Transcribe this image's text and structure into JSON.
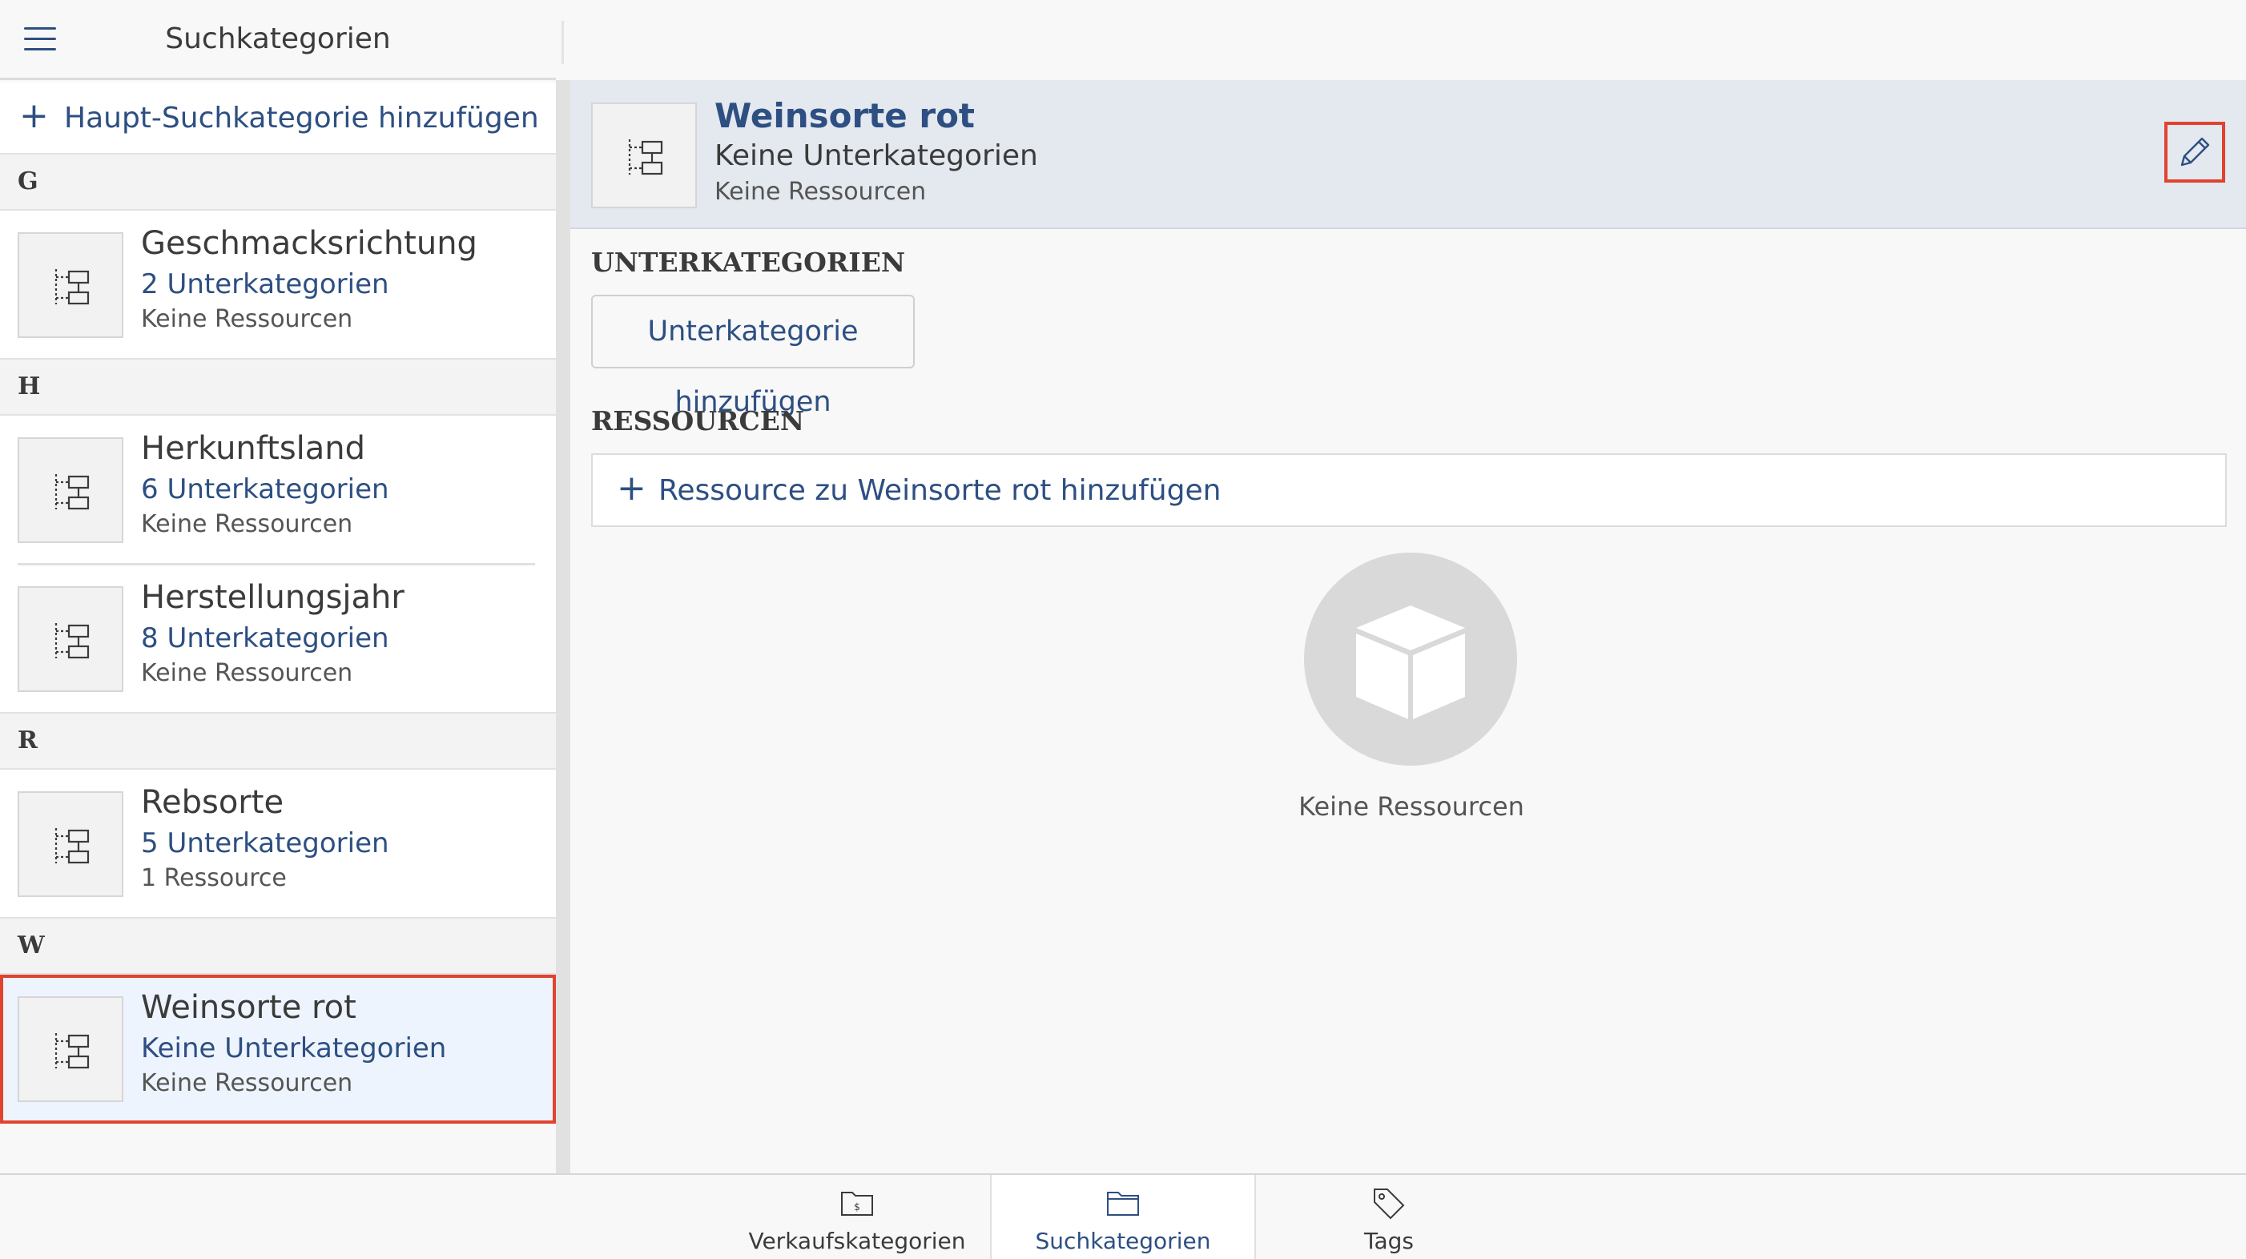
{
  "sidebar": {
    "title": "Suchkategorien",
    "add_main_label": "Haupt-Suchkategorie hinzufügen",
    "sections": [
      {
        "letter": "G",
        "items": [
          {
            "name": "Geschmacksrichtung",
            "sub": "2 Unterkategorien",
            "res": "Keine Ressourcen"
          }
        ]
      },
      {
        "letter": "H",
        "items": [
          {
            "name": "Herkunftsland",
            "sub": "6 Unterkategorien",
            "res": "Keine Ressourcen"
          },
          {
            "name": "Herstellungsjahr",
            "sub": "8 Unterkategorien",
            "res": "Keine Ressourcen"
          }
        ]
      },
      {
        "letter": "R",
        "items": [
          {
            "name": "Rebsorte",
            "sub": "5 Unterkategorien",
            "res": "1 Ressource"
          }
        ]
      },
      {
        "letter": "W",
        "items": [
          {
            "name": "Weinsorte rot",
            "sub": "Keine Unterkategorien",
            "res": "Keine Ressourcen",
            "selected": true
          }
        ]
      }
    ]
  },
  "detail": {
    "name": "Weinsorte rot",
    "sub": "Keine Unterkategorien",
    "res": "Keine Ressourcen",
    "edit_icon": "pencil-icon",
    "subcategories_title": "UNTERKATEGORIEN",
    "add_subcategory_label": "Unterkategorie hinzufügen",
    "resources_title": "RESSOURCEN",
    "add_resource_label": "Ressource zu Weinsorte rot hinzufügen",
    "empty_text": "Keine Ressourcen",
    "empty_icon": "box-icon"
  },
  "tabs": [
    {
      "label": "Verkaufskategorien",
      "icon": "folder-dollar-icon",
      "active": false
    },
    {
      "label": "Suchkategorien",
      "icon": "folder-icon",
      "active": true
    },
    {
      "label": "Tags",
      "icon": "tag-icon",
      "active": false
    }
  ],
  "colors": {
    "accent": "#2d4f82",
    "highlight": "#e0432e",
    "selected_bg": "#eef4fd",
    "header_bg": "#e4e8ef"
  }
}
